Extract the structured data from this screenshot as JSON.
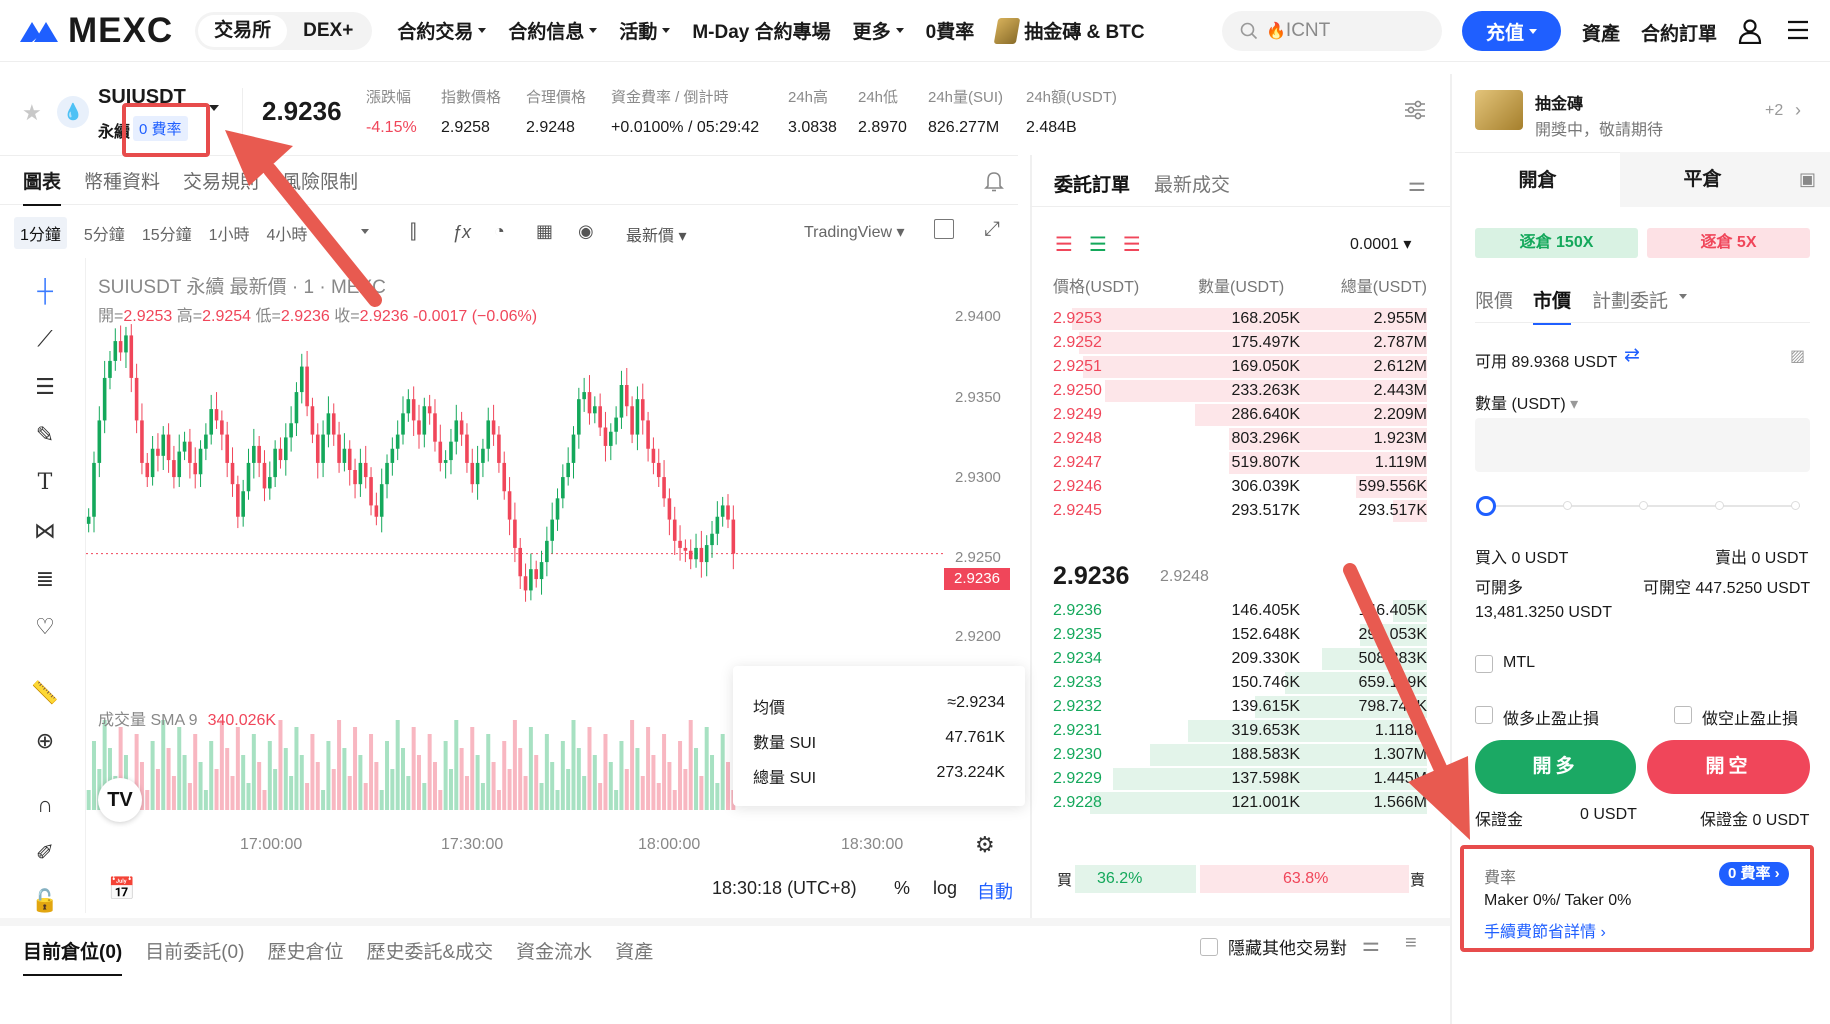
{
  "nav": {
    "logo": "MEXC",
    "seg": [
      "交易所",
      "DEX+"
    ],
    "items": [
      "合約交易",
      "合約信息",
      "活動",
      "M-Day 合約專場",
      "更多",
      "0費率",
      "抽金磚 & BTC"
    ],
    "search_placeholder": "ICNT",
    "deposit": "充值",
    "assets": "資產",
    "contract_orders": "合約訂單"
  },
  "ticker": {
    "symbol": "SUIUSDT",
    "perp": "永續",
    "fee_badge": "0 費率",
    "last_price": "2.9236",
    "stats": [
      {
        "label": "漲跌幅",
        "value": "-4.15%"
      },
      {
        "label": "指數價格",
        "value": "2.9258"
      },
      {
        "label": "合理價格",
        "value": "2.9248"
      },
      {
        "label": "資金費率 / 倒計時",
        "value": "+0.0100% / 05:29:42"
      },
      {
        "label": "24h高",
        "value": "3.0838"
      },
      {
        "label": "24h低",
        "value": "2.8970"
      },
      {
        "label": "24h量(SUI)",
        "value": "826.277M"
      },
      {
        "label": "24h額(USDT)",
        "value": "2.484B"
      }
    ]
  },
  "chart_tabs": [
    "圖表",
    "幣種資料",
    "交易規則",
    "風險限制"
  ],
  "timeframes": [
    "1分鐘",
    "5分鐘",
    "15分鐘",
    "1小時",
    "4小時"
  ],
  "chart_toolbar": {
    "price_type": "最新價",
    "view": "TradingView"
  },
  "chart": {
    "title": "SUIUSDT 永續 最新價 · 1 · MEXC",
    "ohlc": {
      "open": "2.9253",
      "high": "2.9254",
      "low": "2.9236",
      "close": "2.9236",
      "change": "-0.0017 (−0.06%)"
    },
    "ohlc_labels": {
      "o": "開=",
      "h": "高=",
      "l": "低=",
      "c": "收="
    },
    "price_ticks": [
      "2.9400",
      "2.9350",
      "2.9300",
      "2.9250",
      "2.9200"
    ],
    "current_price_tag": "2.9236",
    "volume_label": "成交量 SMA 9",
    "volume_value": "340.026K",
    "time_ticks": [
      "17:00:00",
      "17:30:00",
      "18:00:00",
      "18:30:00"
    ],
    "clock": "18:30:18 (UTC+8)",
    "pct": "%",
    "log": "log",
    "auto": "自動",
    "tv_logo": "TV"
  },
  "tooltip": [
    {
      "label": "均價",
      "value": "≈2.9234"
    },
    {
      "label": "數量 SUI",
      "value": "47.761K"
    },
    {
      "label": "總量 SUI",
      "value": "273.224K"
    }
  ],
  "chart_data": {
    "type": "candlestick",
    "title": "SUIUSDT 永續 最新價 · 1 · MEXC",
    "x": [
      "17:00:00",
      "17:30:00",
      "18:00:00",
      "18:30:00"
    ],
    "ylim": [
      2.9175,
      2.9415
    ],
    "last": 2.9236,
    "closes": [
      2.9262,
      2.93,
      2.933,
      2.936,
      2.9372,
      2.9386,
      2.9378,
      2.939,
      2.936,
      2.933,
      2.93,
      2.929,
      2.931,
      2.9305,
      2.932,
      2.9302,
      2.929,
      2.9308,
      2.9315,
      2.93,
      2.9292,
      2.931,
      2.932,
      2.9338,
      2.933,
      2.932,
      2.93,
      2.9285,
      2.9262,
      2.928,
      2.93,
      2.9312,
      2.93,
      2.9282,
      2.929,
      2.931,
      2.9302,
      2.9318,
      2.9328,
      2.935,
      2.9368,
      2.934,
      2.932,
      2.93,
      2.932,
      2.9335,
      2.932,
      2.93,
      2.931,
      2.9295,
      2.9285,
      2.93,
      2.929,
      2.927,
      2.9262,
      2.9285,
      2.93,
      2.931,
      2.932,
      2.9335,
      2.9345,
      2.933,
      2.932,
      2.934,
      2.9335,
      2.9315,
      2.93,
      2.9302,
      2.9315,
      2.933,
      2.932,
      2.93,
      2.9285,
      2.93,
      2.931,
      2.933,
      2.932,
      2.93,
      2.928,
      2.926,
      2.924,
      2.922,
      2.921,
      2.9225,
      2.9218,
      2.923,
      2.9245,
      2.926,
      2.9275,
      2.929,
      2.93,
      2.932,
      2.9345,
      2.935,
      2.9335,
      2.934,
      2.9325,
      2.9312,
      2.9322,
      2.9332,
      2.9355,
      2.934,
      2.932,
      2.9345,
      2.933,
      2.931,
      2.93,
      2.929,
      2.9275,
      2.926,
      2.9245,
      2.924,
      2.9238,
      2.9232,
      2.924,
      2.923,
      2.9242,
      2.925,
      2.9262,
      2.927,
      2.926,
      2.9236
    ],
    "volume_max": 1.0
  },
  "orderbook": {
    "tabs": [
      "委託訂單",
      "最新成交"
    ],
    "precision": "0.0001",
    "headers": [
      "價格(USDT)",
      "數量(USDT)",
      "總量(USDT)"
    ],
    "asks": [
      {
        "p": "2.9253",
        "q": "168.205K",
        "t": "2.955M",
        "d": 0.95
      },
      {
        "p": "2.9252",
        "q": "175.497K",
        "t": "2.787M",
        "d": 0.93
      },
      {
        "p": "2.9251",
        "q": "169.050K",
        "t": "2.612M",
        "d": 0.92
      },
      {
        "p": "2.9250",
        "q": "233.263K",
        "t": "2.443M",
        "d": 0.86
      },
      {
        "p": "2.9249",
        "q": "286.640K",
        "t": "2.209M",
        "d": 0.62
      },
      {
        "p": "2.9248",
        "q": "803.296K",
        "t": "1.923M",
        "d": 0.53
      },
      {
        "p": "2.9247",
        "q": "519.807K",
        "t": "1.119M",
        "d": 0.53
      },
      {
        "p": "2.9246",
        "q": "306.039K",
        "t": "599.556K",
        "d": 0.19
      },
      {
        "p": "2.9245",
        "q": "293.517K",
        "t": "293.517K",
        "d": 0.09
      }
    ],
    "mid": "2.9236",
    "mid_fair": "2.9248",
    "bids": [
      {
        "p": "2.9236",
        "q": "146.405K",
        "t": "146.405K",
        "d": 0.09
      },
      {
        "p": "2.9235",
        "q": "152.648K",
        "t": "299.053K",
        "d": 0.18
      },
      {
        "p": "2.9234",
        "q": "209.330K",
        "t": "508.383K",
        "d": 0.28
      },
      {
        "p": "2.9233",
        "q": "150.746K",
        "t": "659.129K",
        "d": 0.38
      },
      {
        "p": "2.9232",
        "q": "139.615K",
        "t": "798.744K",
        "d": 0.46
      },
      {
        "p": "2.9231",
        "q": "319.653K",
        "t": "1.118M",
        "d": 0.64
      },
      {
        "p": "2.9230",
        "q": "188.583K",
        "t": "1.307M",
        "d": 0.74
      },
      {
        "p": "2.9229",
        "q": "137.598K",
        "t": "1.445M",
        "d": 0.84
      },
      {
        "p": "2.9228",
        "q": "121.001K",
        "t": "1.566M",
        "d": 0.9
      }
    ],
    "buy_label": "買",
    "sell_label": "賣",
    "buy_pct": "36.2%",
    "sell_pct": "63.8%",
    "buy_ratio": 0.362
  },
  "positions_tabs": [
    "目前倉位(0)",
    "目前委託(0)",
    "歷史倉位",
    "歷史委託&成交",
    "資金流水",
    "資產"
  ],
  "hide_other": "隱藏其他交易對",
  "trade": {
    "promo_title": "抽金磚",
    "promo_sub": "開獎中，敬請期待",
    "promo_more": "+2",
    "tabs": [
      "開倉",
      "平倉"
    ],
    "lev_long": "逐倉 150X",
    "lev_short": "逐倉 5X",
    "order_types": [
      "限價",
      "市價",
      "計劃委託"
    ],
    "available": "可用 89.9368 USDT",
    "qty_label": "數量 (USDT)",
    "slider_level": 0,
    "buy_label": "買入 0 USDT",
    "sell_label": "賣出 0 USDT",
    "can_long_label": "可開多",
    "can_long_val": "13,481.3250 USDT",
    "can_short": "可開空 447.5250 USDT",
    "mtl": "MTL",
    "tp_long": "做多止盈止損",
    "tp_short": "做空止盈止損",
    "btn_long": "開多",
    "btn_short": "開空",
    "margin_l_label": "保證金",
    "margin_l_val": "0 USDT",
    "margin_r": "保證金 0 USDT",
    "fee_title": "費率",
    "fee_badge": "0 費率 ›",
    "fee_text": "Maker 0%/ Taker 0%",
    "fee_link": "手續費節省詳情 ›"
  }
}
